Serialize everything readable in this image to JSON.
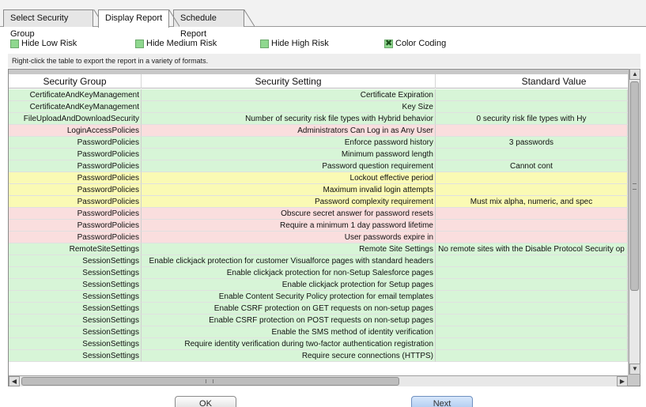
{
  "tabs": [
    {
      "label": "Select Security Group"
    },
    {
      "label": "Display Report"
    },
    {
      "label": "Schedule Report"
    }
  ],
  "options": {
    "hide_low": "Hide Low Risk",
    "hide_medium": "Hide Medium Risk",
    "hide_high": "Hide High Risk",
    "color_coding": "Color Coding"
  },
  "info_text": "Right-click the table to export the report in a variety of formats.",
  "table": {
    "headers": [
      "Security Group",
      "Security Setting",
      "Standard Value"
    ],
    "rows": [
      {
        "group": "CertificateAndKeyManagement",
        "setting": "Certificate Expiration",
        "value": "",
        "risk": "low"
      },
      {
        "group": "CertificateAndKeyManagement",
        "setting": "Key Size",
        "value": "",
        "risk": "low"
      },
      {
        "group": "FileUploadAndDownloadSecurity",
        "setting": "Number of security risk file types with Hybrid behavior",
        "value": "0 security risk file types with Hy",
        "risk": "low"
      },
      {
        "group": "LoginAccessPolicies",
        "setting": "Administrators Can Log in as Any User",
        "value": "",
        "risk": "high"
      },
      {
        "group": "PasswordPolicies",
        "setting": "Enforce password history",
        "value": "3 passwords",
        "risk": "low"
      },
      {
        "group": "PasswordPolicies",
        "setting": "Minimum password length",
        "value": "",
        "risk": "low"
      },
      {
        "group": "PasswordPolicies",
        "setting": "Password question requirement",
        "value": "Cannot cont",
        "risk": "low"
      },
      {
        "group": "PasswordPolicies",
        "setting": "Lockout effective period",
        "value": "",
        "risk": "medium"
      },
      {
        "group": "PasswordPolicies",
        "setting": "Maximum invalid login attempts",
        "value": "",
        "risk": "medium"
      },
      {
        "group": "PasswordPolicies",
        "setting": "Password complexity requirement",
        "value": "Must mix alpha, numeric, and spec",
        "risk": "medium"
      },
      {
        "group": "PasswordPolicies",
        "setting": "Obscure secret answer for password resets",
        "value": "",
        "risk": "high"
      },
      {
        "group": "PasswordPolicies",
        "setting": "Require a minimum 1 day password lifetime",
        "value": "",
        "risk": "high"
      },
      {
        "group": "PasswordPolicies",
        "setting": "User passwords expire in",
        "value": "",
        "risk": "high"
      },
      {
        "group": "RemoteSiteSettings",
        "setting": "Remote Site Settings",
        "value": "No remote sites with the Disable Protocol Security op",
        "risk": "low"
      },
      {
        "group": "SessionSettings",
        "setting": "Enable clickjack protection for customer Visualforce pages with standard headers",
        "value": "",
        "risk": "low"
      },
      {
        "group": "SessionSettings",
        "setting": "Enable clickjack protection for non-Setup Salesforce pages",
        "value": "",
        "risk": "low"
      },
      {
        "group": "SessionSettings",
        "setting": "Enable clickjack protection for Setup pages",
        "value": "",
        "risk": "low"
      },
      {
        "group": "SessionSettings",
        "setting": "Enable Content Security Policy protection for email templates",
        "value": "",
        "risk": "low"
      },
      {
        "group": "SessionSettings",
        "setting": "Enable CSRF protection on GET requests on non-setup pages",
        "value": "",
        "risk": "low"
      },
      {
        "group": "SessionSettings",
        "setting": "Enable CSRF protection on POST requests on non-setup pages",
        "value": "",
        "risk": "low"
      },
      {
        "group": "SessionSettings",
        "setting": "Enable the SMS method of identity verification",
        "value": "",
        "risk": "low"
      },
      {
        "group": "SessionSettings",
        "setting": "Require identity verification during two-factor authentication registration",
        "value": "",
        "risk": "low"
      },
      {
        "group": "SessionSettings",
        "setting": "Require secure connections (HTTPS)",
        "value": "",
        "risk": "low"
      }
    ]
  },
  "buttons": {
    "ok": "OK",
    "next": "Next"
  },
  "colors": {
    "low": "#d7f5d7",
    "medium": "#fafab4",
    "high": "#fadede"
  }
}
